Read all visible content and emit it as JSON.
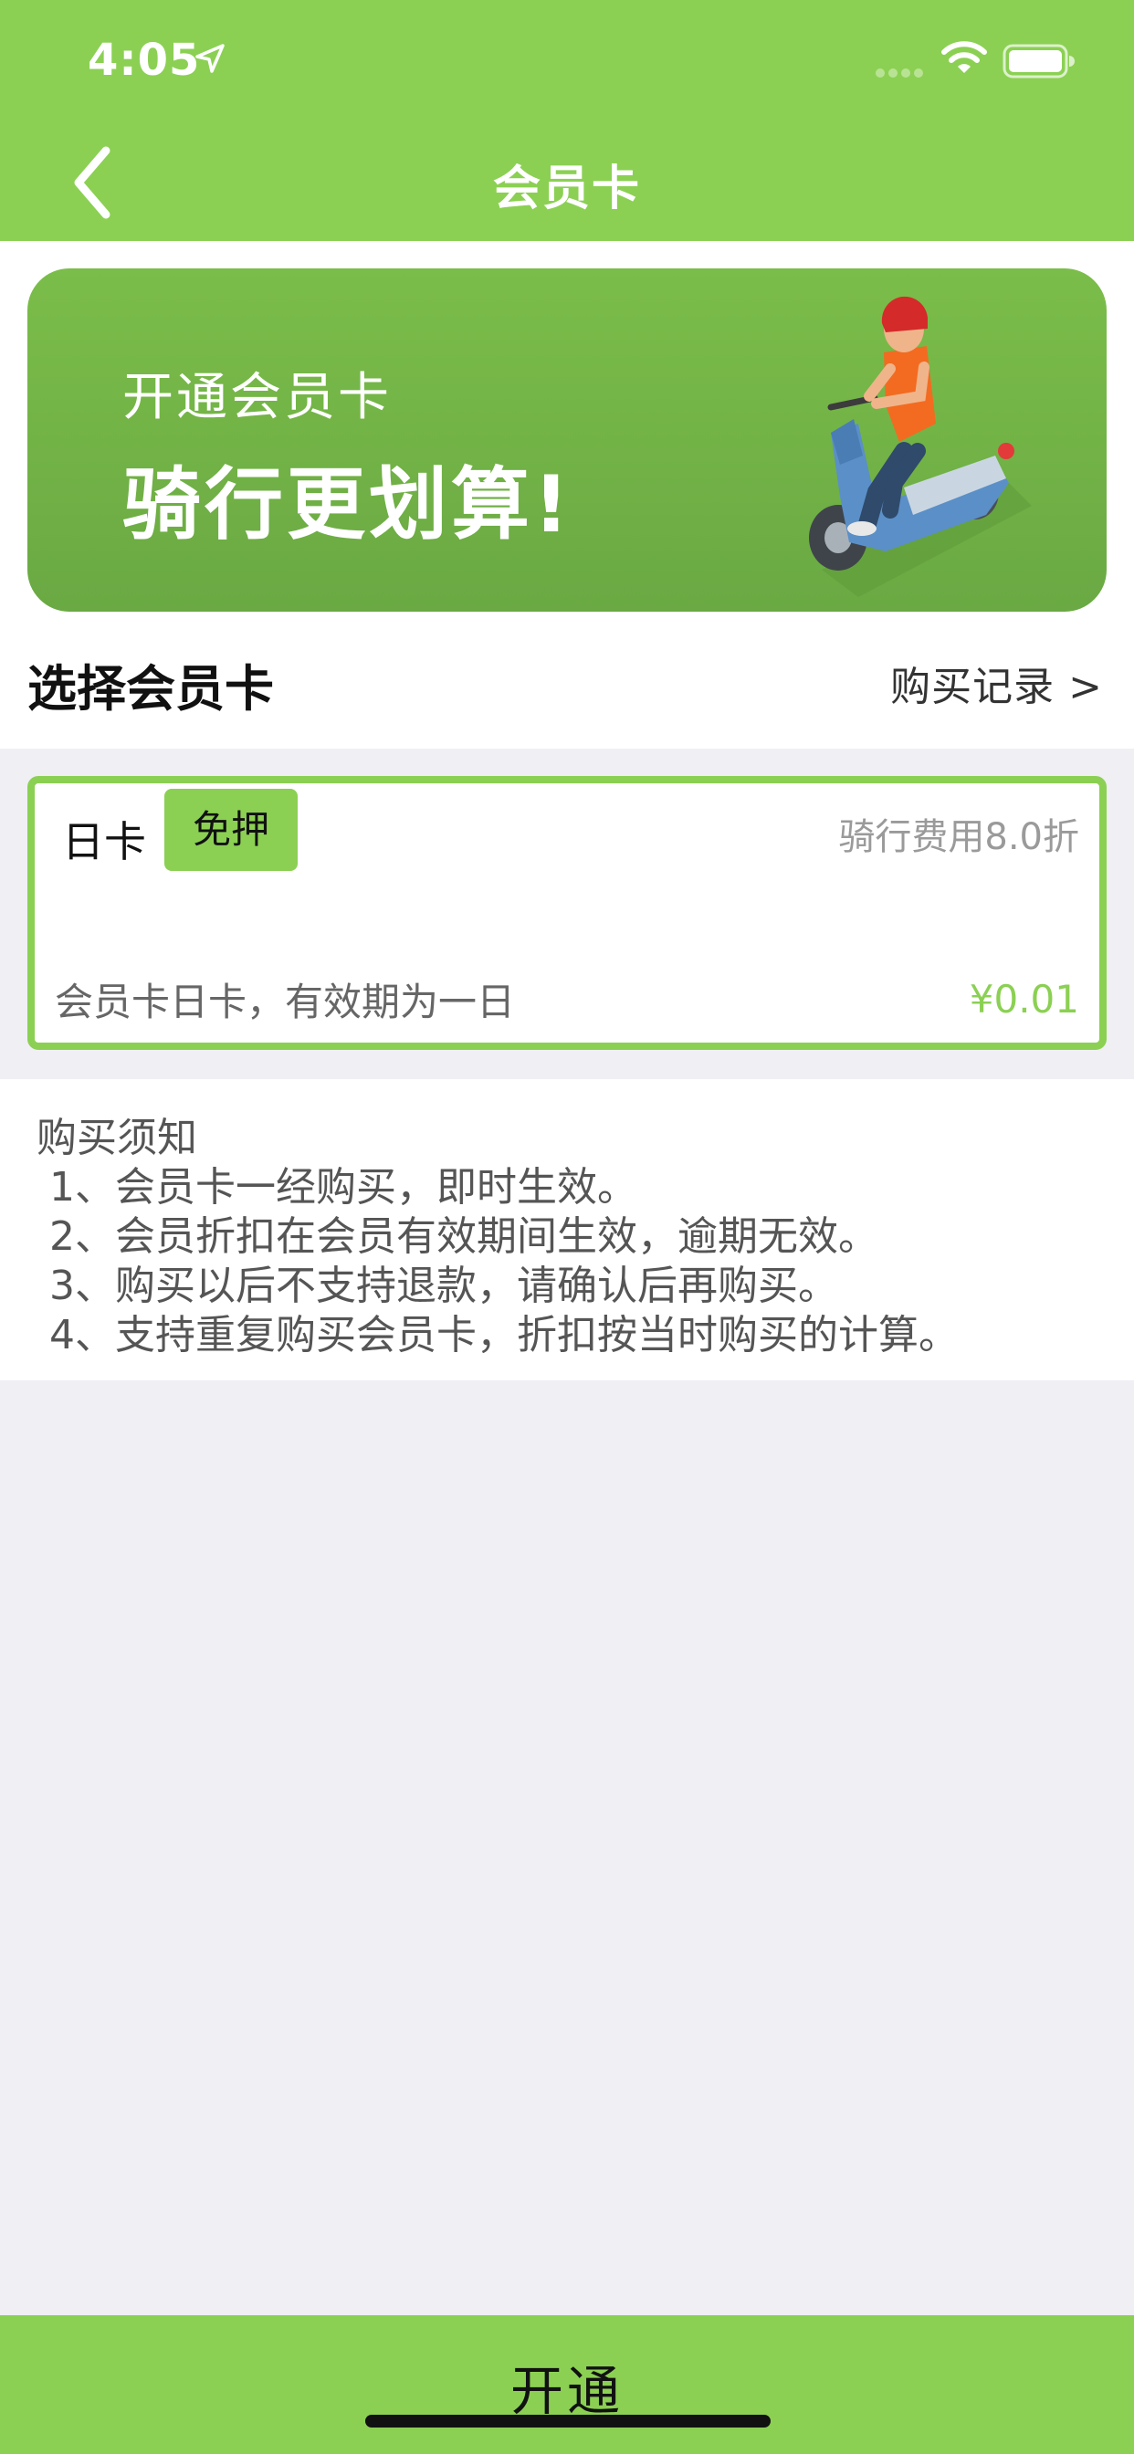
{
  "status_bar": {
    "time": "4:05"
  },
  "nav": {
    "title": "会员卡",
    "back_icon": "chevron-left-icon"
  },
  "banner": {
    "subtitle": "开通会员卡",
    "headline": "骑行更划算!",
    "illustration": "scooter-rider"
  },
  "section": {
    "title": "选择会员卡",
    "records_link": "购买记录 >"
  },
  "card": {
    "name": "日卡",
    "badge": "免押",
    "discount": "骑行费用8.0折",
    "description": "会员卡日卡，有效期为一日",
    "price": "¥0.01"
  },
  "notice": {
    "title": "购买须知",
    "lines": [
      "1、会员卡一经购买，即时生效。",
      "2、会员折扣在会员有效期间生效，逾期无效。",
      "3、购买以后不支持退款，请确认后再购买。",
      "4、支持重复购买会员卡，折扣按当时购买的计算。"
    ]
  },
  "bottom": {
    "button_label": "开通"
  },
  "colors": {
    "accent": "#8bd053",
    "banner": "#72b046",
    "background": "#efeff4"
  }
}
